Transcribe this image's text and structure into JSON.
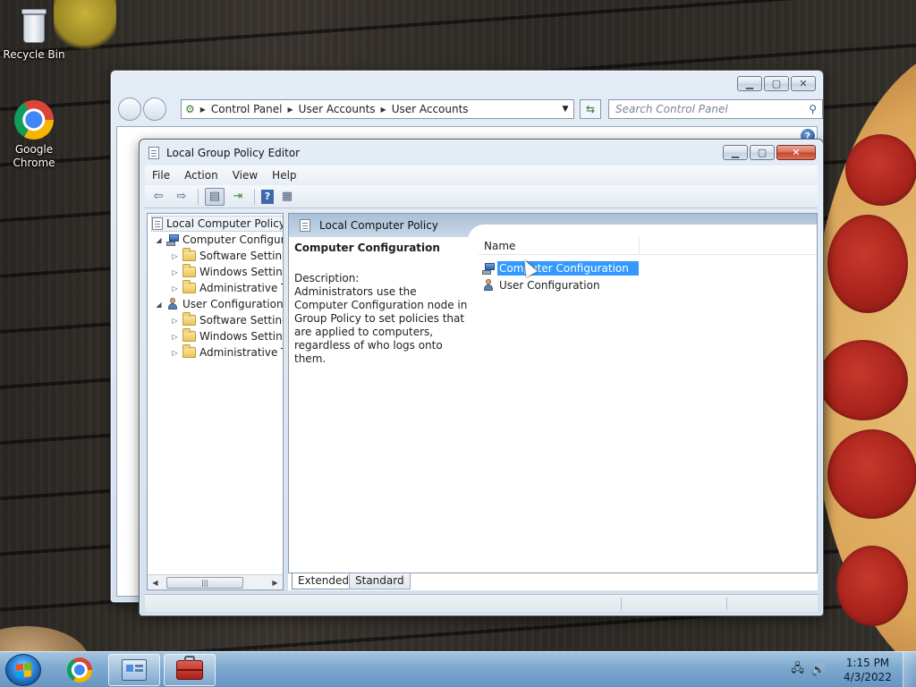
{
  "desktop": {
    "icons": [
      {
        "label": "Recycle Bin"
      },
      {
        "label": "Google\nChrome",
        "line1": "Google",
        "line2": "Chrome"
      }
    ]
  },
  "control_panel": {
    "breadcrumb": [
      "Control Panel",
      "User Accounts",
      "User Accounts"
    ],
    "search_placeholder": "Search Control Panel",
    "help_glyph": "?"
  },
  "gpo": {
    "title": "Local Group Policy Editor",
    "menu": [
      "File",
      "Action",
      "View",
      "Help"
    ],
    "tree": {
      "root": "Local Computer Policy",
      "computer_config": "Computer Configura",
      "computer_children": [
        "Software Settings",
        "Windows Setting",
        "Administrative Te"
      ],
      "user_config": "User Configuration",
      "user_children": [
        "Software Settings",
        "Windows Setting",
        "Administrative Te"
      ]
    },
    "right": {
      "header": "Local Computer Policy",
      "desc_title": "Computer Configuration",
      "desc_label": "Description:",
      "desc_body": "Administrators use the Computer Configuration node in Group Policy to set policies that are applied to computers, regardless of who logs onto them.",
      "column_name": "Name",
      "items": [
        {
          "label": "Computer Configuration",
          "selected": true
        },
        {
          "label": "User Configuration",
          "selected": false
        }
      ]
    },
    "tabs": [
      "Extended",
      "Standard"
    ],
    "active_tab": "Extended"
  },
  "taskbar": {
    "time": "1:15 PM",
    "date": "4/3/2022"
  },
  "colors": {
    "selection": "#3399ff",
    "taskbar": "#82afd7"
  }
}
